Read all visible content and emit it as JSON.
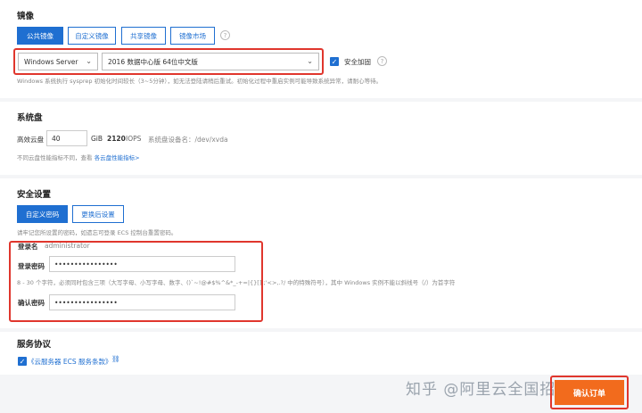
{
  "image": {
    "title": "镜像",
    "tabs": [
      {
        "label": "公共镜像",
        "active": true
      },
      {
        "label": "自定义镜像",
        "active": false
      },
      {
        "label": "共享镜像",
        "active": false
      },
      {
        "label": "镜像市场",
        "active": false
      }
    ],
    "os_type": "Windows Server",
    "os_version": "2016 数据中心版 64位中文版",
    "security_hardening": "安全加固",
    "note": "Windows 系统执行 sysprep 初始化时间较长（3~5分钟），如无法登陆请稍后重试。初始化过程中重启实例可能导致系统异常，请耐心等待。"
  },
  "disk": {
    "title": "系统盘",
    "type": "高效云盘",
    "size": "40",
    "unit": "GiB",
    "iops": "2120",
    "iops_unit": "IOPS",
    "device_label": "系统盘设备名：/dev/xvda",
    "note_prefix": "不同云盘性能指标不同，查看",
    "note_link": "各云盘性能指标>"
  },
  "security": {
    "title": "安全设置",
    "tabs": [
      {
        "label": "自定义密码",
        "active": true
      },
      {
        "label": "更换后设置",
        "active": false
      }
    ],
    "note": "请牢记您所设置的密码，如遗忘可登录 ECS 控制台重置密码。",
    "login_label": "登录名",
    "login_value": "administrator",
    "password_label": "登录密码",
    "password_value": "••••••••••••••••",
    "password_hint": "8 - 30 个字符，必须同时包含三项（大写字母、小写字母、数字、()`~!@#$%^&*_-+=|{}[]:;'<>,.?/ 中的特殊符号），其中 Windows 实例不能以斜线号（/）为首字符",
    "confirm_label": "确认密码",
    "confirm_value": "••••••••••••••••"
  },
  "agreement": {
    "title": "服务协议",
    "text": "《云服务器 ECS 服务条款》"
  },
  "footer": {
    "confirm_button": "确认订单",
    "watermark": "知乎 @阿里云全国招募"
  },
  "colors": {
    "primary": "#1f6fd1",
    "highlight": "#e0362d",
    "order_button": "#f26b1d"
  }
}
